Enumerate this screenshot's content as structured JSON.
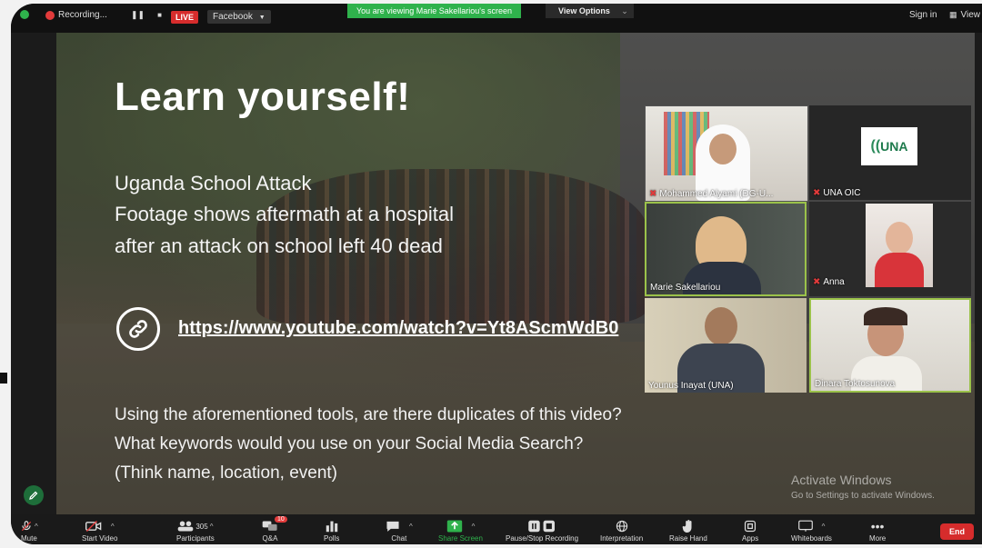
{
  "topbar": {
    "recording_label": "Recording...",
    "live_label": "LIVE",
    "stream_target": "Facebook",
    "viewing_banner": "You are viewing Marie Sakellariou's screen",
    "view_options": "View Options",
    "sign_in": "Sign in",
    "view_label": "View"
  },
  "slide": {
    "title": "Learn yourself!",
    "lines": [
      "Uganda School Attack",
      "Footage shows aftermath at a hospital",
      "after an attack on school left 40 dead"
    ],
    "link": "https://www.youtube.com/watch?v=Yt8AScmWdB0",
    "questions": [
      "Using the aforementioned tools, are there duplicates of this video?",
      "What keywords would you use on your Social Media Search?",
      "(Think name, location, event)"
    ],
    "watermark_title": "Activate Windows",
    "watermark_sub": "Go to Settings to activate Windows."
  },
  "participants": [
    {
      "name": "Mohammed Alyami (DG-U..."
    },
    {
      "name": "UNA OIC"
    },
    {
      "name": "Marie Sakellariou"
    },
    {
      "name": "Anna"
    },
    {
      "name": "Younus Inayat (UNA)"
    },
    {
      "name": "Dinara Toktosunova"
    }
  ],
  "una_logo_text": "UNA",
  "toolbar": {
    "mute": "Mute",
    "start_video": "Start Video",
    "participants": "Participants",
    "participants_count": "305",
    "qa": "Q&A",
    "qa_badge": "10",
    "polls": "Polls",
    "chat": "Chat",
    "share_screen": "Share Screen",
    "pause_recording": "Pause/Stop Recording",
    "interpretation": "Interpretation",
    "raise_hand": "Raise Hand",
    "apps": "Apps",
    "whiteboards": "Whiteboards",
    "more": "More",
    "end": "End"
  },
  "colors": {
    "accent_green": "#2fb24c",
    "end_red": "#d62c2c"
  }
}
